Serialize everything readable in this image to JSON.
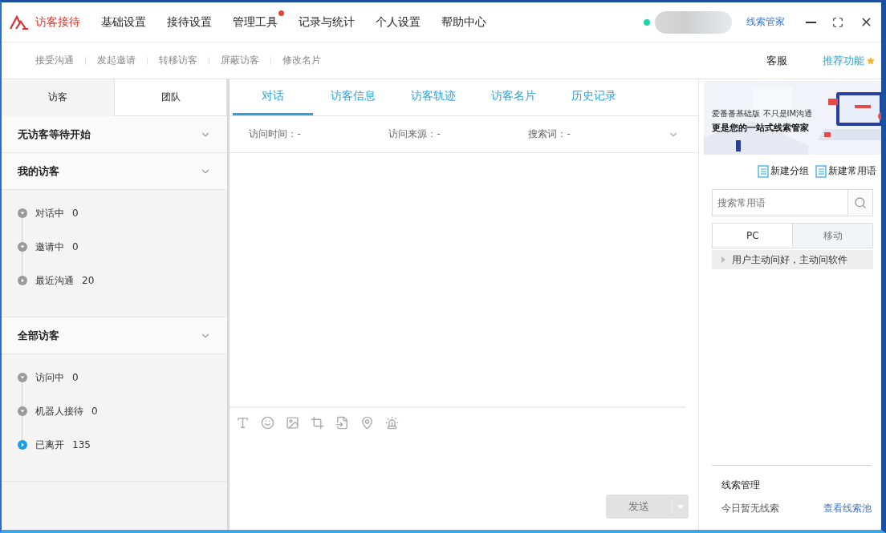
{
  "nav": {
    "items": [
      {
        "label": "访客接待",
        "selected": true,
        "badge": false
      },
      {
        "label": "基础设置",
        "selected": false,
        "badge": false
      },
      {
        "label": "接待设置",
        "selected": false,
        "badge": false
      },
      {
        "label": "管理工具",
        "selected": false,
        "badge": true
      },
      {
        "label": "记录与统计",
        "selected": false,
        "badge": false
      },
      {
        "label": "个人设置",
        "selected": false,
        "badge": false
      },
      {
        "label": "帮助中心",
        "selected": false,
        "badge": false
      }
    ],
    "online": true,
    "link": "线索管家"
  },
  "toolbar": {
    "actions": [
      "接受沟通",
      "发起邀请",
      "转移访客",
      "屏蔽访客",
      "修改名片"
    ],
    "service": "客服",
    "recommend": "推荐功能"
  },
  "left": {
    "tabs": [
      {
        "label": "访客",
        "selected": true
      },
      {
        "label": "团队",
        "selected": false
      }
    ],
    "groups": [
      {
        "title": "无访客等待开始"
      },
      {
        "title": "我的访客",
        "items": [
          {
            "label": "对话中",
            "count": "0",
            "expanded": true,
            "selected": false
          },
          {
            "label": "邀请中",
            "count": "0",
            "expanded": true,
            "selected": false
          },
          {
            "label": "最近沟通",
            "count": "20",
            "expanded": false,
            "selected": false
          }
        ]
      },
      {
        "title": "全部访客",
        "items": [
          {
            "label": "访问中",
            "count": "0",
            "expanded": true,
            "selected": false
          },
          {
            "label": "机器人接待",
            "count": "0",
            "expanded": true,
            "selected": false
          },
          {
            "label": "已离开",
            "count": "135",
            "expanded": false,
            "selected": true
          }
        ]
      }
    ]
  },
  "center": {
    "tabs": [
      {
        "label": "对话",
        "selected": true
      },
      {
        "label": "访客信息",
        "selected": false
      },
      {
        "label": "访客轨迹",
        "selected": false
      },
      {
        "label": "访客名片",
        "selected": false
      },
      {
        "label": "历史记录",
        "selected": false
      }
    ],
    "info": [
      {
        "label": "访问时间：",
        "value": "-"
      },
      {
        "label": "访问来源：",
        "value": "-"
      },
      {
        "label": "搜索词：",
        "value": "-"
      }
    ],
    "send": {
      "label": "发送",
      "disabled": true
    }
  },
  "right": {
    "banner": {
      "line1": "爱番番基础版 不只是IM沟通",
      "line2": "更是您的一站式线索管家"
    },
    "actions": [
      "新建分组",
      "新建常用语"
    ],
    "search": {
      "placeholder": "搜索常用语"
    },
    "tabs": [
      {
        "label": "PC",
        "selected": true
      },
      {
        "label": "移动",
        "selected": false
      }
    ],
    "phrases": [
      "用户主动问好，主动问软件"
    ],
    "leads": {
      "title": "线索管理",
      "empty": "今日暂无线索",
      "link": "查看线索池"
    }
  }
}
